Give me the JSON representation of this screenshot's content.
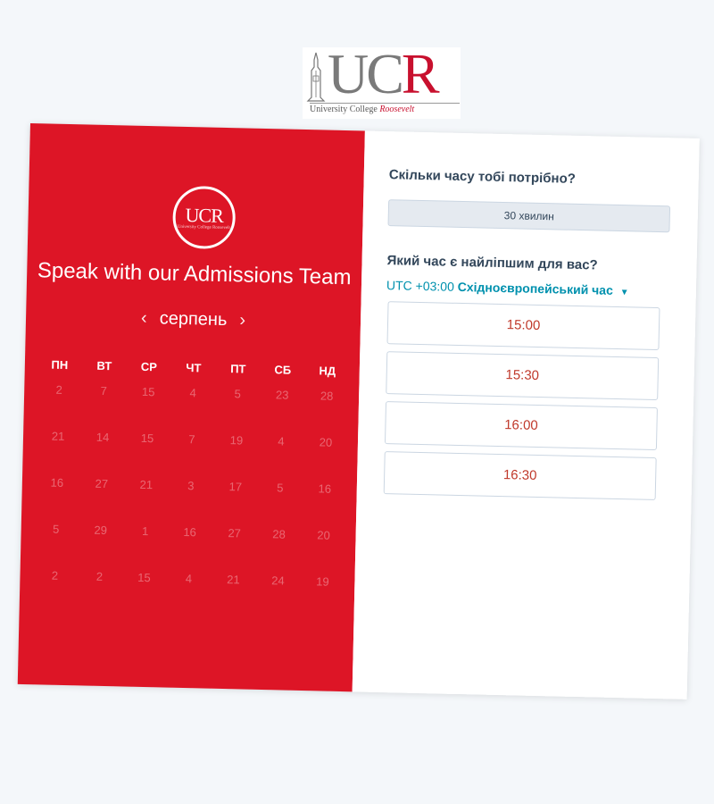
{
  "logo": {
    "letters_gray": "UC",
    "letter_red": "R",
    "subtitle_main": "University College",
    "subtitle_italic": "Roosevelt"
  },
  "left_panel": {
    "badge_letters": "UCR",
    "badge_sub": "University College Roosevelt",
    "heading": "Speak with our Admissions Team",
    "month": "серпень",
    "prev_icon": "‹",
    "next_icon": "›",
    "weekdays": [
      "ПН",
      "ВТ",
      "СР",
      "ЧТ",
      "ПТ",
      "СБ",
      "НД"
    ],
    "days": [
      [
        "2",
        "7",
        "15",
        "4",
        "5",
        "23",
        "28"
      ],
      [
        "21",
        "14",
        "15",
        "7",
        "19",
        "4",
        "20"
      ],
      [
        "16",
        "27",
        "21",
        "3",
        "17",
        "5",
        "16"
      ],
      [
        "5",
        "29",
        "1",
        "16",
        "27",
        "28",
        "20"
      ],
      [
        "2",
        "2",
        "15",
        "4",
        "21",
        "24",
        "19"
      ]
    ]
  },
  "right_panel": {
    "duration_question": "Скільки часу тобі потрібно?",
    "duration_value": "30 хвилин",
    "time_question": "Який час є найліпшим для вас?",
    "timezone_offset": "UTC +03:00",
    "timezone_name": "Східноєвропейський час",
    "time_slots": [
      "15:00",
      "15:30",
      "16:00",
      "16:30"
    ]
  },
  "colors": {
    "brand_red": "#dd1526",
    "link_teal": "#0091ae",
    "slot_text": "#c0392b"
  }
}
